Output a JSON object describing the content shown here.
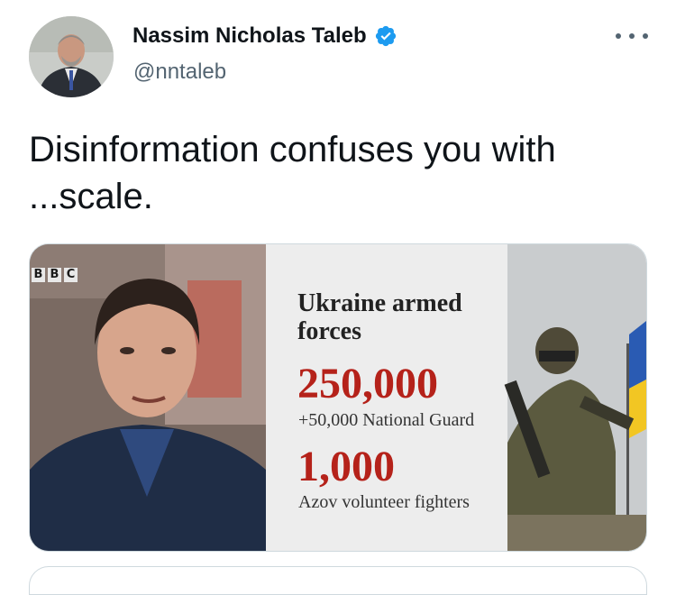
{
  "author": {
    "name": "Nassim Nicholas Taleb",
    "handle": "@nntaleb",
    "verified": true
  },
  "tweet": {
    "text": "Disinformation confuses you with\n...scale."
  },
  "media": {
    "logo_letters": [
      "B",
      "B",
      "C"
    ],
    "title": "Ukraine armed forces",
    "figure1": "250,000",
    "figure1_caption": "+50,000 National Guard",
    "figure2": "1,000",
    "figure2_caption": "Azov volunteer fighters"
  },
  "colors": {
    "text_primary": "#0f1419",
    "text_secondary": "#536471",
    "verified_blue": "#1d9bf0",
    "figure_red": "#b5221a",
    "border": "#cfd9de"
  },
  "icons": {
    "verified": "verified-badge-icon",
    "more": "more-options-icon"
  }
}
